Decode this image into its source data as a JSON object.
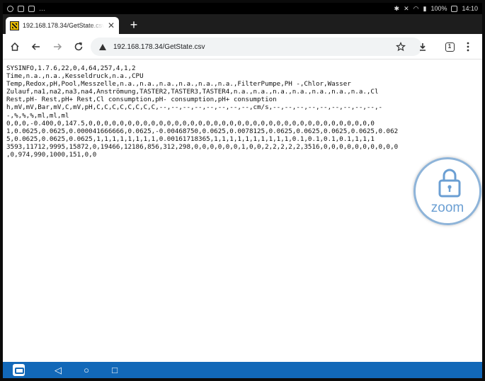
{
  "statusbar": {
    "battery": "100%",
    "time": "14:10",
    "left_text": "…"
  },
  "tab": {
    "title": "192.168.178.34/GetState.csv",
    "close_glyph": "✕",
    "new_tab_glyph": "+"
  },
  "toolbar": {
    "url": "192.168.178.34/GetState.csv",
    "tab_count": "1",
    "icons": [
      "home-icon",
      "back-icon",
      "forward-icon",
      "reload-icon",
      "not-secure-icon",
      "star-icon",
      "download-icon",
      "tab-count-icon",
      "menu-icon"
    ]
  },
  "document": {
    "lines": [
      "SYSINFO,1.7.6,22,0,4,64,257,4,1,2",
      "Time,n.a.,n.a.,Kesseldruck,n.a.,CPU",
      "Temp,Redox,pH,Pool,Messzelle,n.a.,n.a.,n.a.,n.a.,n.a.,n.a.,FilterPumpe,PH -,Chlor,Wasser",
      "Zulauf,na1,na2,na3,na4,Anströmung,TASTER2,TASTER3,TASTER4,n.a.,n.a.,n.a.,n.a.,n.a.,n.a.,n.a.,Cl",
      "Rest,pH- Rest,pH+ Rest,Cl consumption,pH- consumption,pH+ consumption",
      "h,mV,mV,Bar,mV,C,mV,pH,C,C,C,C,C,C,C,C,--,--,--,--,--,--,--,--,cm/s,--,--,--,--,--,--,--,--,--,-",
      "-,%,%,%,ml,ml,ml",
      "0,0,0,-0.400,0,147.5,0,0,0,0,0,0,0,0,0,0,0,0,0,0,0,0,0,0,0,0,0,0,0,0,0,0,0,0,0,0,0,0,0,0,0,0,0",
      "1,0.0625,0.0625,0.000041666666,0.0625,-0.00468750,0.0625,0.0078125,0.0625,0.0625,0.0625,0.0625,0.062",
      "5,0.0625,0.0625,0.0625,1,1,1,1,1,1,1,1,0.00161718365,1,1,1,1,1,1,1,1,1,1,0.1,0.1,0.1,0.1,1,1,1",
      "3593,11712,9995,15872,0,19466,12186,856,312,298,0,0,0,0,0,0,1,0,0,2,2,2,2,2,3516,0,0,0,0,0,0,0,0,0,0",
      ",0,974,990,1000,151,0,0"
    ]
  },
  "overlay": {
    "zoom_label": "zoom"
  },
  "navbar": {
    "back_glyph": "◁",
    "home_glyph": "○",
    "recents_glyph": "□"
  }
}
